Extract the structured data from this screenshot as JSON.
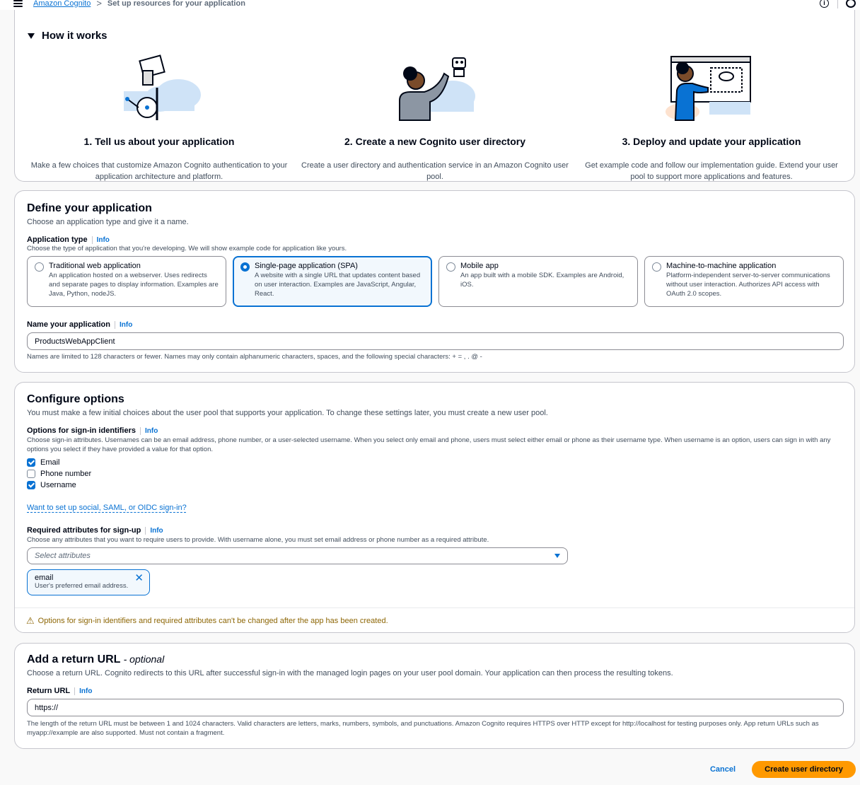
{
  "breadcrumb": {
    "root": "Amazon Cognito",
    "separator": ">",
    "current": "Set up resources for your application"
  },
  "how_it_works": {
    "title": "How it works",
    "steps": [
      {
        "title": "1. Tell us about your application",
        "desc": "Make a few choices that customize Amazon Cognito authentication to your application architecture and platform."
      },
      {
        "title": "2. Create a new Cognito user directory",
        "desc": "Create a user directory and authentication service in an Amazon Cognito user pool."
      },
      {
        "title": "3. Deploy and update your application",
        "desc": "Get example code and follow our implementation guide. Extend your user pool to support more applications and features."
      }
    ]
  },
  "define": {
    "title": "Define your application",
    "desc": "Choose an application type and give it a name.",
    "app_type_label": "Application type",
    "info": "Info",
    "app_type_hint": "Choose the type of application that you're developing. We will show example code for application like yours.",
    "tiles": [
      {
        "title": "Traditional web application",
        "desc": "An application hosted on a webserver. Uses redirects and separate pages to display information. Examples are Java, Python, nodeJS.",
        "selected": false
      },
      {
        "title": "Single-page application (SPA)",
        "desc": "A website with a single URL that updates content based on user interaction. Examples are JavaScript, Angular, React.",
        "selected": true
      },
      {
        "title": "Mobile app",
        "desc": "An app built with a mobile SDK. Examples are Android, iOS.",
        "selected": false
      },
      {
        "title": "Machine-to-machine application",
        "desc": "Platform-independent server-to-server communications without user interaction. Authorizes API access with OAuth 2.0 scopes.",
        "selected": false
      }
    ],
    "name_label": "Name your application",
    "name_value": "ProductsWebAppClient",
    "name_hint": "Names are limited to 128 characters or fewer. Names may only contain alphanumeric characters, spaces, and the following special characters: + = , . @ -"
  },
  "configure": {
    "title": "Configure options",
    "desc": "You must make a few initial choices about the user pool that supports your application. To change these settings later, you must create a new user pool.",
    "signin_label": "Options for sign-in identifiers",
    "signin_hint": "Choose sign-in attributes. Usernames can be an email address, phone number, or a user-selected username. When you select only email and phone, users must select either email or phone as their username type. When username is an option, users can sign in with any options you select if they have provided a value for that option.",
    "checkboxes": [
      {
        "label": "Email",
        "checked": true
      },
      {
        "label": "Phone number",
        "checked": false
      },
      {
        "label": "Username",
        "checked": true
      }
    ],
    "social_link": "Want to set up social, SAML, or OIDC sign-in?",
    "required_label": "Required attributes for sign-up",
    "required_hint": "Choose any attributes that you want to require users to provide. With username alone, you must set email address or phone number as a required attribute.",
    "select_placeholder": "Select attributes",
    "token_name": "email",
    "token_desc": "User's preferred email address.",
    "warning": "Options for sign-in identifiers and required attributes can't be changed after the app has been created."
  },
  "return_url": {
    "title": "Add a return URL",
    "optional": "- optional",
    "desc": "Choose a return URL. Cognito redirects to this URL after successful sign-in with the managed login pages on your user pool domain. Your application can then process the resulting tokens.",
    "label": "Return URL",
    "value": "https://",
    "hint": "The length of the return URL must be between 1 and 1024 characters. Valid characters are letters, marks, numbers, symbols, and punctuations. Amazon Cognito requires HTTPS over HTTP except for http://localhost for testing purposes only. App return URLs such as myapp://example are also supported. Must not contain a fragment."
  },
  "actions": {
    "cancel": "Cancel",
    "create": "Create user directory"
  },
  "colors": {
    "primary": "#0972d3",
    "accent_button": "#ff9900",
    "warning": "#8d6605",
    "border": "#c6c6cd"
  }
}
